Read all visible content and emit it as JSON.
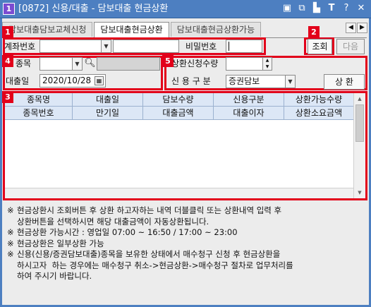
{
  "window": {
    "number_badge": "1",
    "title": "[0872] 신용/대출 - 담보대출 현금상환",
    "icons": [
      "window-tile-icon",
      "copy-icon",
      "bookmark-icon",
      "font-size-icon",
      "help-icon",
      "close-icon"
    ]
  },
  "tabs": [
    {
      "label": "담보대출담보교체신청",
      "active": false
    },
    {
      "label": "담보대출현금상환",
      "active": true
    },
    {
      "label": "담보대출현금상환가능",
      "active": false
    }
  ],
  "tab_nav": {
    "prev": "◀",
    "next": "▶"
  },
  "markers": {
    "m1": "1",
    "m2": "2",
    "m3": "3",
    "m4": "4",
    "m5": "5"
  },
  "account": {
    "label": "계좌번호",
    "account_value": "",
    "name_value": "",
    "password_label": "비밀번호",
    "password_value": ""
  },
  "actions": {
    "query": "조회",
    "next": "다음"
  },
  "left_form": {
    "item_label": "종목",
    "item_value": "",
    "item_name_value": "",
    "loan_date_label": "대출일",
    "loan_date_value": "2020/10/28"
  },
  "right_form": {
    "qty_label": "상환신청수량",
    "qty_value": "",
    "credit_type_label": "신 용 구 분",
    "credit_type_value": "증권담보",
    "repay_button": "상 환"
  },
  "grid": {
    "header_row1": [
      "종목명",
      "대출일",
      "담보수량",
      "신용구분",
      "상환가능수량"
    ],
    "header_row2": [
      "종목번호",
      "만기일",
      "대출금액",
      "대출이자",
      "상환소요금액"
    ],
    "rows": []
  },
  "notes": [
    "현금상환시 조회버튼 후 상환 하고자하는 내역 더블클릭 또는 상환내역 입력 후\n상환버튼을 선택하시면 해당 대출금액이 자동상환됩니다.",
    "현금상환 가능시간 : 영업일 07:00 ~ 16:50 / 17:00 ~ 23:00",
    "현금상환은 일부상환 가능",
    "신용(신용/증권담보대출)종목을 보유한 상태에서 매수청구 신청 후 현금상환을\n하시고자  하는 경우에는 매수청구 취소->현금상환->매수청구 절차로 업무처리를\n하여 주시기 바랍니다."
  ],
  "note_marker": "※"
}
